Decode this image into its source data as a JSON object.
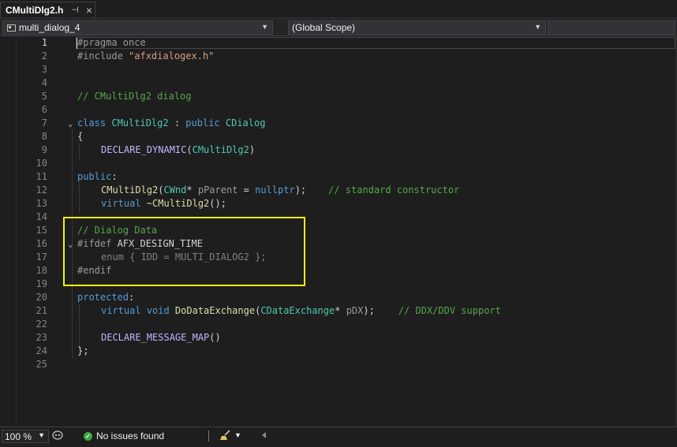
{
  "tab": {
    "title": "CMultiDlg2.h",
    "pin_glyph": "⊣",
    "close_glyph": "×"
  },
  "navbar": {
    "project": "multi_dialog_4",
    "scope": "(Global Scope)"
  },
  "editor": {
    "line_numbers": [
      "1",
      "2",
      "3",
      "4",
      "5",
      "6",
      "7",
      "8",
      "9",
      "10",
      "11",
      "12",
      "13",
      "14",
      "15",
      "16",
      "17",
      "18",
      "19",
      "20",
      "21",
      "22",
      "23",
      "24",
      "25"
    ],
    "code": {
      "l1_directive": "#pragma once",
      "l2_directive": "#include ",
      "l2_string": "\"afxdialogex.h\"",
      "l5_comment": "// CMultiDlg2 dialog",
      "l7_kw_class": "class ",
      "l7_name": "CMultiDlg2",
      "l7_colon": " : ",
      "l7_kw_public": "public ",
      "l7_base": "CDialog",
      "l8_brace": "{",
      "l9_macro": "DECLARE_DYNAMIC",
      "l9_open": "(",
      "l9_arg": "CMultiDlg2",
      "l9_close": ")",
      "l11_access": "public",
      "l11_colon": ":",
      "l12_func": "CMultiDlg2",
      "l12_open": "(",
      "l12_type": "CWnd",
      "l12_star": "* ",
      "l12_param": "pParent",
      "l12_eq": " = ",
      "l12_null": "nullptr",
      "l12_close": ");",
      "l12_comment": "// standard constructor",
      "l13_kw": "virtual ",
      "l13_func": "~CMultiDlg2",
      "l13_rest": "();",
      "l15_comment": "// Dialog Data",
      "l16_directive": "#ifdef ",
      "l16_macro": "AFX_DESIGN_TIME",
      "l17_inactive": "enum { IDD = MULTI_DIALOG2 };",
      "l18_directive": "#endif",
      "l20_access": "protected",
      "l20_colon": ":",
      "l21_kw1": "virtual ",
      "l21_kw2": "void ",
      "l21_func": "DoDataExchange",
      "l21_open": "(",
      "l21_type": "CDataExchange",
      "l21_star": "* ",
      "l21_param": "pDX",
      "l21_close": ");",
      "l21_comment": "// DDX/DDV support",
      "l23_macro": "DECLARE_MESSAGE_MAP",
      "l23_paren": "()",
      "l24_end": "};"
    }
  },
  "statusbar": {
    "zoom": "100 %",
    "issues": "No issues found"
  },
  "colors": {
    "accent": "#0e639c",
    "highlight_box": "#f2f20c",
    "ok_green": "#3fa53f"
  }
}
